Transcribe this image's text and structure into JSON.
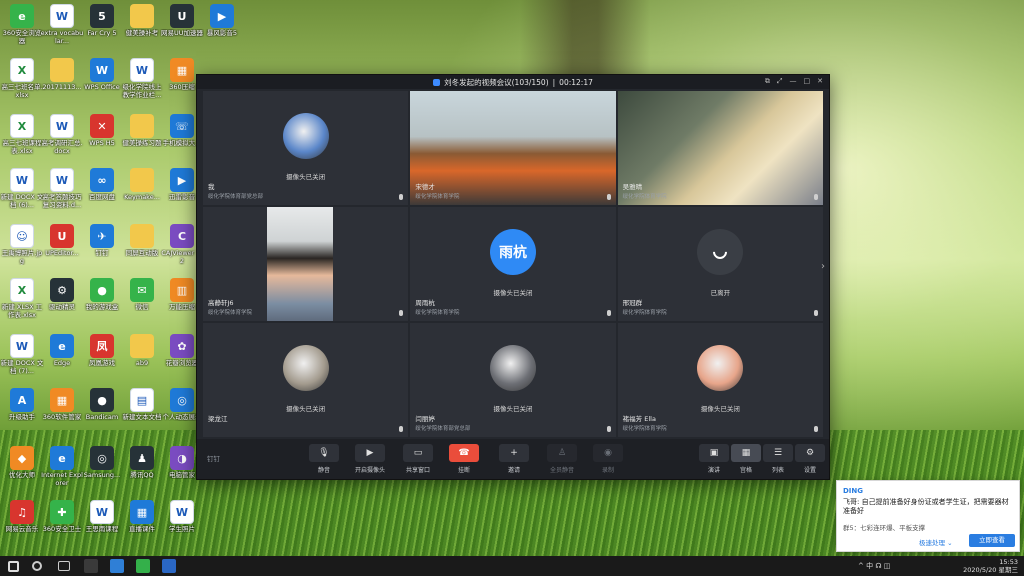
{
  "desktop": {
    "icons": [
      {
        "label": "360安全浏览器",
        "glyph": "e",
        "style": "g-green"
      },
      {
        "label": "extra vocabular...",
        "glyph": "W",
        "style": "g-doc"
      },
      {
        "label": "Far Cry 5",
        "glyph": "5",
        "style": "g-dark"
      },
      {
        "label": "健美操补考",
        "glyph": "",
        "style": "g-folder"
      },
      {
        "label": "网易UU加速器",
        "glyph": "U",
        "style": "g-dark"
      },
      {
        "label": "暴风影音5",
        "glyph": "▶",
        "style": "g-blue"
      },
      {
        "label": "高三七班名单.xlsx",
        "glyph": "X",
        "style": "g-xls"
      },
      {
        "label": "20171113...",
        "glyph": "",
        "style": "g-folder"
      },
      {
        "label": "WPS Office",
        "glyph": "W",
        "style": "g-blue"
      },
      {
        "label": "级化学院线上教学作业栏...",
        "glyph": "W",
        "style": "g-doc"
      },
      {
        "label": "360压缩",
        "glyph": "▦",
        "style": "g-orange"
      },
      {
        "label": "高三七班课程表.xlsx",
        "glyph": "X",
        "style": "g-xls"
      },
      {
        "label": "高考调研汇总.docx",
        "glyph": "W",
        "style": "g-doc"
      },
      {
        "label": "WPS H5",
        "glyph": "✕",
        "style": "g-red"
      },
      {
        "label": "健美操练习题",
        "glyph": "",
        "style": "g-folder"
      },
      {
        "label": "手机模拟大...",
        "glyph": "☏",
        "style": "g-blue"
      },
      {
        "label": "新建 DOCX 文档 (6)...",
        "glyph": "W",
        "style": "g-doc"
      },
      {
        "label": "高考答题技巧复习资料.d...",
        "glyph": "W",
        "style": "g-doc"
      },
      {
        "label": "百度网盘",
        "glyph": "∞",
        "style": "g-blue"
      },
      {
        "label": "Keymake...",
        "glyph": "",
        "style": "g-folder"
      },
      {
        "label": "迅雷影音",
        "glyph": "▶",
        "style": "g-blue"
      },
      {
        "label": "王禹博照片.jpg",
        "glyph": "☺",
        "style": "g-doc"
      },
      {
        "label": "UPEditor...",
        "glyph": "U",
        "style": "g-red"
      },
      {
        "label": "钉钉",
        "glyph": "✈",
        "style": "g-blue"
      },
      {
        "label": "同屏互动版",
        "glyph": "",
        "style": "g-folder"
      },
      {
        "label": "CAJViewer 7.2",
        "glyph": "C",
        "style": "g-purple"
      },
      {
        "label": "新建 XLSX 工作表.xlsx",
        "glyph": "X",
        "style": "g-xls"
      },
      {
        "label": "驱动精灵",
        "glyph": "⚙",
        "style": "g-dark"
      },
      {
        "label": "我的游戏盒",
        "glyph": "●",
        "style": "g-green"
      },
      {
        "label": "微信",
        "glyph": "✉",
        "style": "g-green"
      },
      {
        "label": "万能压缩",
        "glyph": "▥",
        "style": "g-orange"
      },
      {
        "label": "新建 DOCX 文档 (7)...",
        "glyph": "W",
        "style": "g-doc"
      },
      {
        "label": "Edge",
        "glyph": "e",
        "style": "g-blue"
      },
      {
        "label": "凤凰游戏",
        "glyph": "凤",
        "style": "g-red"
      },
      {
        "label": "ab9",
        "glyph": "",
        "style": "g-folder"
      },
      {
        "label": "花瓣浏览器",
        "glyph": "✿",
        "style": "g-purple"
      },
      {
        "label": "升级助手",
        "glyph": "A",
        "style": "g-blue"
      },
      {
        "label": "360软件管家",
        "glyph": "▦",
        "style": "g-orange"
      },
      {
        "label": "Bandicam",
        "glyph": "●",
        "style": "g-dark"
      },
      {
        "label": "新建文本文档",
        "glyph": "▤",
        "style": "g-doc"
      },
      {
        "label": "个人动态展示",
        "glyph": "◎",
        "style": "g-blue"
      },
      {
        "label": "优化大师",
        "glyph": "◆",
        "style": "g-orange"
      },
      {
        "label": "Internet Explorer",
        "glyph": "e",
        "style": "g-blue"
      },
      {
        "label": "Samsung...",
        "glyph": "◎",
        "style": "g-dark"
      },
      {
        "label": "腾讯QQ",
        "glyph": "♟",
        "style": "g-dark"
      },
      {
        "label": "电脑管家",
        "glyph": "◑",
        "style": "g-purple"
      },
      {
        "label": "网易云音乐",
        "glyph": "♫",
        "style": "g-red"
      },
      {
        "label": "360安全卫士",
        "glyph": "✚",
        "style": "g-green"
      },
      {
        "label": "王思雨课程",
        "glyph": "W",
        "style": "g-doc"
      },
      {
        "label": "直播课件",
        "glyph": "▦",
        "style": "g-blue"
      },
      {
        "label": "学生照片",
        "glyph": "W",
        "style": "g-doc"
      },
      {
        "label": "健美操考核内容.docx",
        "glyph": "W",
        "style": "g-doc"
      }
    ]
  },
  "meeting": {
    "title": "刘冬发起的视频会议(103/150)",
    "separator": "|",
    "timer": "00:12:17",
    "controls": [
      "⧉",
      "⤢",
      "—",
      "□",
      "✕"
    ],
    "next_arrow": "›",
    "tiles": [
      {
        "name": "我",
        "org": "绥化学院体育部党总部",
        "status": "摄像头已关闭",
        "kind": "avatar",
        "color": "#5a86c9"
      },
      {
        "name": "宋德才",
        "org": "绥化学院体育学院",
        "status": "",
        "kind": "video-a"
      },
      {
        "name": "吴雅晴",
        "org": "绥化学院体育学院",
        "status": "",
        "kind": "video-b"
      },
      {
        "name": "高静轩J6",
        "org": "绥化学院体育学院",
        "status": "",
        "kind": "video-c"
      },
      {
        "name": "周雨杭",
        "org": "绥化学院体育学院",
        "status": "摄像头已关闭",
        "kind": "text",
        "avatar_text": "雨杭"
      },
      {
        "name": "邢冠群",
        "org": "绥化学院体育学院",
        "status": "已离开",
        "kind": "phone"
      },
      {
        "name": "梁龙江",
        "org": "",
        "status": "摄像头已关闭",
        "kind": "avatar",
        "color": "#a39b8e"
      },
      {
        "name": "闫丽婷",
        "org": "绥化学院体育部党总部",
        "status": "摄像头已关闭",
        "kind": "avatar",
        "color": "#6d6f75"
      },
      {
        "name": "褚福芳 Ella",
        "org": "绥化学院体育学院",
        "status": "摄像头已关闭",
        "kind": "avatar",
        "color": "#e7a58a"
      }
    ],
    "toolbar": {
      "left_label": "钉钉",
      "buttons": [
        {
          "label": "静音",
          "glyph": "🎙",
          "state": "normal"
        },
        {
          "label": "开启摄像头",
          "glyph": "▶",
          "state": "normal"
        },
        {
          "label": "共享窗口",
          "glyph": "▭",
          "state": "normal"
        },
        {
          "label": "挂断",
          "glyph": "☎",
          "state": "hang"
        },
        {
          "label": "邀请",
          "glyph": "+",
          "state": "normal"
        },
        {
          "label": "全员静音",
          "glyph": "♙",
          "state": "dim"
        },
        {
          "label": "录制",
          "glyph": "◉",
          "state": "dim"
        },
        {
          "label": "演讲",
          "glyph": "▣",
          "state": "normal"
        },
        {
          "label": "宫格",
          "glyph": "▦",
          "state": "active"
        },
        {
          "label": "列表",
          "glyph": "☰",
          "state": "normal"
        },
        {
          "label": "设置",
          "glyph": "⚙",
          "state": "normal"
        }
      ]
    }
  },
  "notification": {
    "app": "DING",
    "message": "飞哥: 自己提前准备好身份证或者学生证，把需要器材准备好",
    "group": "群5：七彩连环爆、平板支撑",
    "defer_label": "极速处理 ⌄",
    "view_label": "立即查看"
  },
  "taskbar": {
    "tray_glyphs": "^ 中 ☊ ◫",
    "time": "15:53",
    "date": "2020/5/20 星期三"
  }
}
